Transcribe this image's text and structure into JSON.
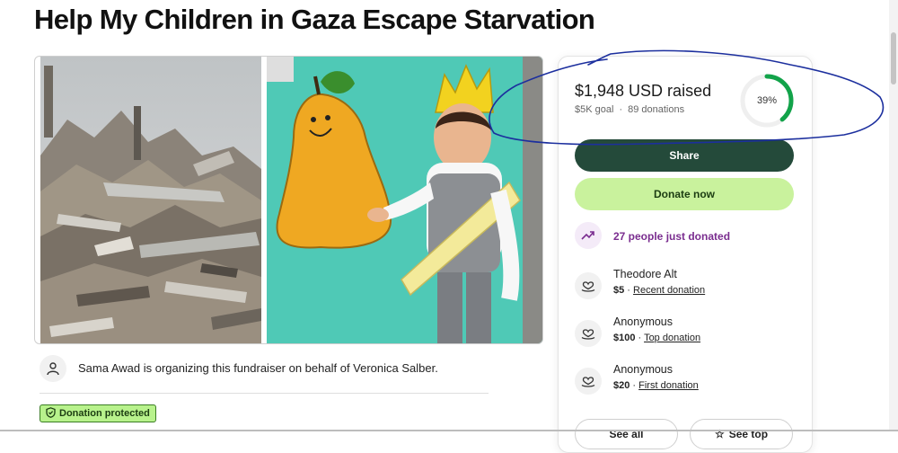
{
  "campaign": {
    "title": "Help My Children in Gaza Escape Starvation"
  },
  "organizer": {
    "text": "Sama Awad is organizing this fundraiser on behalf of Veronica Salber."
  },
  "badge": {
    "label": "Donation protected"
  },
  "progress": {
    "raised": "$1,948 USD raised",
    "goal": "$5K goal",
    "donations": "89 donations",
    "percent_label": "39%",
    "percent": 0.39
  },
  "buttons": {
    "share": "Share",
    "donate": "Donate now",
    "see_all": "See all",
    "see_top": "See top"
  },
  "recent_activity": {
    "label": "27 people just donated"
  },
  "donations": [
    {
      "name": "Theodore Alt",
      "amount": "$5",
      "type": "Recent donation"
    },
    {
      "name": "Anonymous",
      "amount": "$100",
      "type": "Top donation"
    },
    {
      "name": "Anonymous",
      "amount": "$20",
      "type": "First donation"
    }
  ],
  "colors": {
    "share_button": "#244a3a",
    "donate_button": "#c9f29d",
    "progress_ring": "#12a34a",
    "activity_text": "#7a2d8f",
    "annotation_ink": "#1c2f9e"
  }
}
